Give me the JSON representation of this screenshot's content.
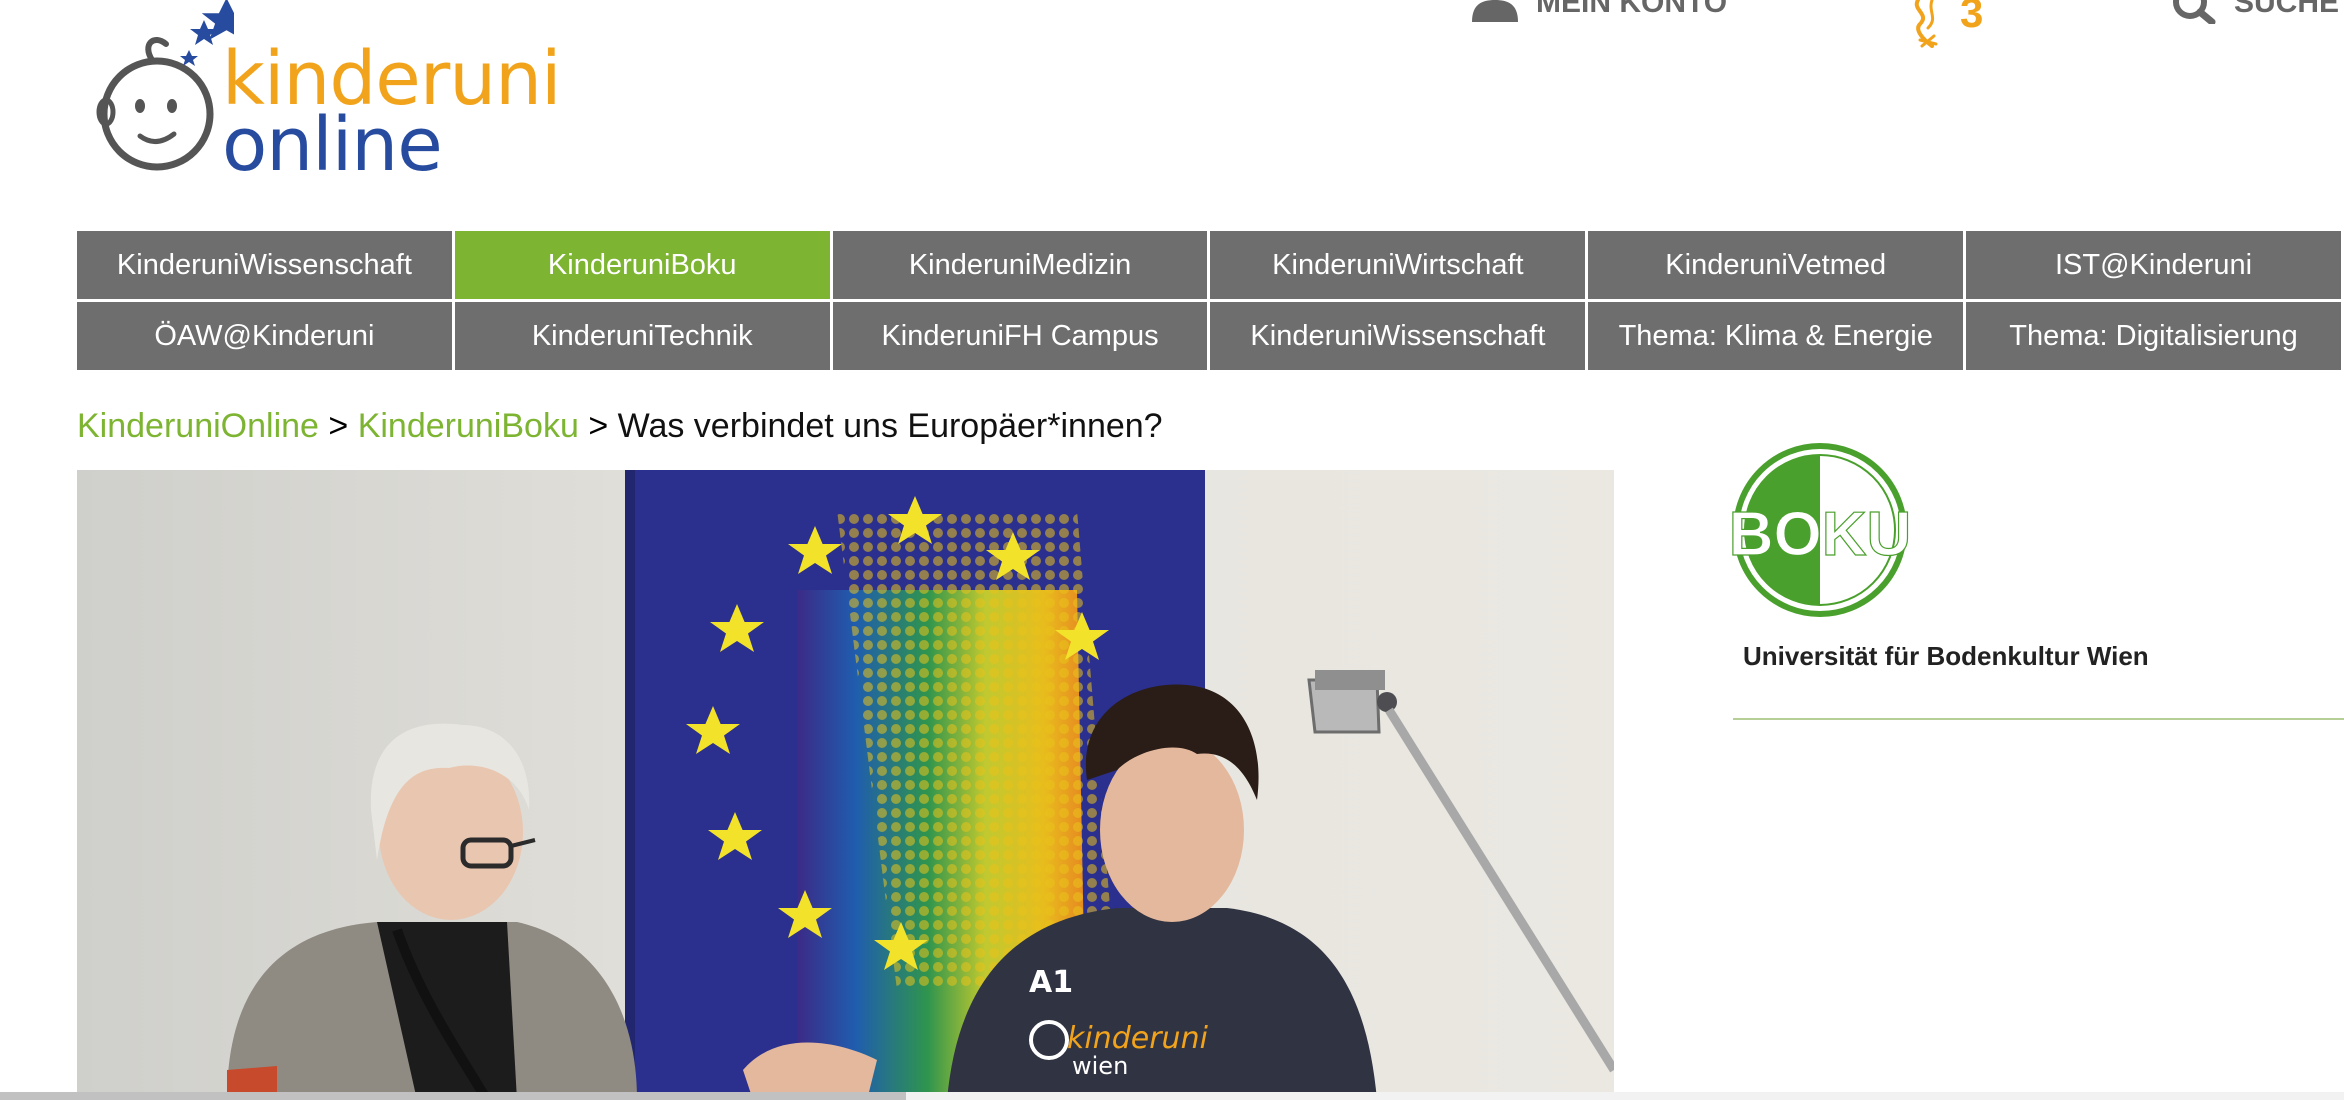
{
  "header": {
    "logo": {
      "line1": "kinderuni",
      "line2": "online",
      "colors": {
        "line1": "#f2a31c",
        "line2": "#274b9f"
      }
    },
    "account": {
      "label": "MEIN KONTO",
      "icon": "user-icon"
    },
    "points": {
      "value": "3",
      "icon": "ribbon-icon"
    },
    "search": {
      "label": "SUCHE",
      "icon": "search-icon"
    }
  },
  "nav": {
    "active_color": "#7db432",
    "default_color": "#6e6e6e",
    "rows": [
      [
        {
          "label": "KinderuniWissenschaft"
        },
        {
          "label": "KinderuniBoku",
          "active": true
        },
        {
          "label": "KinderuniMedizin"
        },
        {
          "label": "KinderuniWirtschaft"
        },
        {
          "label": "KinderuniVetmed"
        },
        {
          "label": "IST@Kinderuni"
        }
      ],
      [
        {
          "label": "ÖAW@Kinderuni"
        },
        {
          "label": "KinderuniTechnik"
        },
        {
          "label": "KinderuniFH Campus"
        },
        {
          "label": "KinderuniWissenschaft"
        },
        {
          "label": "Thema: Klima & Energie"
        },
        {
          "label": "Thema: Digitalisierung"
        }
      ]
    ]
  },
  "breadcrumb": {
    "items": [
      "KinderuniOnline",
      "KinderuniBoku"
    ],
    "separator": ">",
    "current": "Was verbindet uns Europäer*innen?"
  },
  "video": {
    "shirt_text": {
      "brand": "A1",
      "line1": "kinderuni",
      "line2": "wien"
    }
  },
  "sidebar": {
    "logo_text": "BOKU",
    "university_name": "Universität für Bodenkultur Wien",
    "brand_color": "#4aa02c"
  }
}
